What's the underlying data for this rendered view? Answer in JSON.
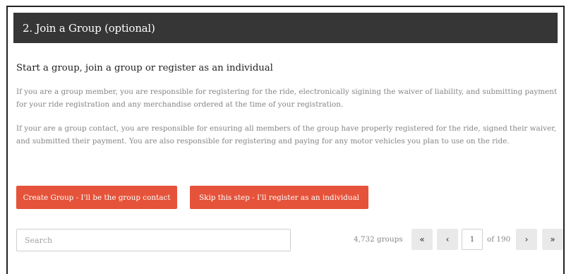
{
  "header": {
    "title": "2. Join a Group (optional)"
  },
  "intro": {
    "subtitle": "Start a group, join a group or register as an individual",
    "paragraph1": "If you are a group member, you are responsible for registering for the ride, electronically sigining the waiver of liability, and submitting payment for your ride registration and any merchandise ordered at the time of your registration.",
    "paragraph2": "If your are a group contact, you are responsible for ensuring all members of the group have properly registered for the ride, signed their waiver, and submitted their payment. You are also responsible for registering and paying for any motor vehicles you plan to use on the ride."
  },
  "actions": {
    "create_label": "Create Group - I'll be the group contact",
    "skip_label": "Skip this step - I'll register as an individual"
  },
  "search": {
    "placeholder": "Search",
    "value": ""
  },
  "pagination": {
    "count_label": "4,732 groups",
    "first_glyph": "«",
    "prev_glyph": "‹",
    "current_page": "1",
    "of_label": "of 190",
    "next_glyph": "›",
    "last_glyph": "»"
  },
  "colors": {
    "header_bg": "#363636",
    "accent": "#e5533a",
    "body_text": "#858585"
  }
}
